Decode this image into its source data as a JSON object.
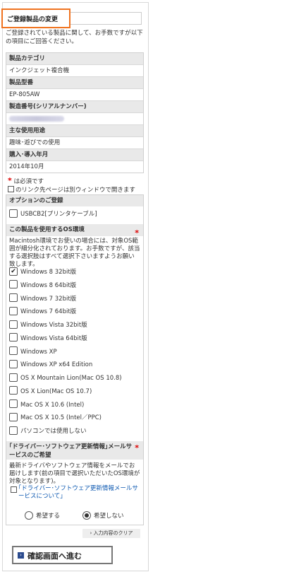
{
  "header": {
    "title": "ご登録製品の変更"
  },
  "intro": "ご登録されている製品に関して、お手数ですが以下の項目にご回答ください。",
  "product_info": [
    {
      "label": "製品カテゴリ",
      "value": "インクジェット複合機"
    },
    {
      "label": "製品型番",
      "value": "EP-805AW"
    },
    {
      "label": "製造番号(シリアルナンバー)",
      "value": ""
    },
    {
      "label": "主な使用用途",
      "value": "趣味･遊びでの使用"
    },
    {
      "label": "購入･導入年月",
      "value": "2014年10月"
    }
  ],
  "notes": {
    "required": "は必須です",
    "required_mark": "*",
    "link_note": "のリンク先ページは別ウィンドウで開きます"
  },
  "options": {
    "title": "オプションのご登録",
    "items": [
      {
        "label": "USBCB2[プリンタケーブル]",
        "checked": false
      }
    ]
  },
  "os": {
    "title": "この製品を使用するOS環境",
    "required_mark": "*",
    "desc": "Macintosh環境でお使いの場合には、対象OS範囲が細分化されております。お手数ですが、該当する選択肢はすべて選択下さいますようお願い致します。",
    "items": [
      {
        "label": "Windows 8 32bit版",
        "checked": true
      },
      {
        "label": "Windows 8 64bit版",
        "checked": false
      },
      {
        "label": "Windows 7 32bit版",
        "checked": false
      },
      {
        "label": "Windows 7 64bit版",
        "checked": false
      },
      {
        "label": "Windows Vista 32bit版",
        "checked": false
      },
      {
        "label": "Windows Vista 64bit版",
        "checked": false
      },
      {
        "label": "Windows XP",
        "checked": false
      },
      {
        "label": "Windows XP x64 Edition",
        "checked": false
      },
      {
        "label": "OS X Mountain Lion(Mac OS 10.8)",
        "checked": false
      },
      {
        "label": "OS X Lion(Mac OS 10.7)",
        "checked": false
      },
      {
        "label": "Mac OS X 10.6 (Intel)",
        "checked": false
      },
      {
        "label": "Mac OS X 10.5 (Intel／PPC)",
        "checked": false
      },
      {
        "label": "パソコンでは使用しない",
        "checked": false
      }
    ]
  },
  "mail": {
    "title": "｢ドライバー･ソフトウェア更新情報｣メールサービスのご希望",
    "required_mark": "*",
    "desc": "最新ドライバやソフトウェア情報をメールでお届けします(前の項目で選択いただいたOS環境が対象となります)。",
    "link": "｢ドライバー･ソフトウェア更新情報メールサービスについて｣",
    "radios": [
      {
        "label": "希望する",
        "selected": false
      },
      {
        "label": "希望しない",
        "selected": true
      }
    ]
  },
  "buttons": {
    "clear": "入力内容のクリア",
    "confirm": "確認画面へ進む"
  }
}
